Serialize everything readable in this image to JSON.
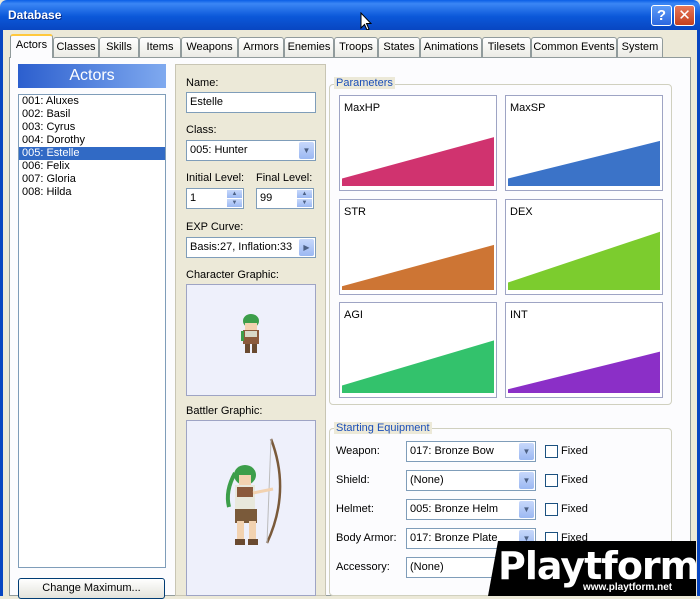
{
  "window": {
    "title": "Database"
  },
  "tabs": [
    "Actors",
    "Classes",
    "Skills",
    "Items",
    "Weapons",
    "Armors",
    "Enemies",
    "Troops",
    "States",
    "Animations",
    "Tilesets",
    "Common Events",
    "System"
  ],
  "actors": {
    "header": "Actors",
    "items": [
      "001: Aluxes",
      "002: Basil",
      "003: Cyrus",
      "004: Dorothy",
      "005: Estelle",
      "006: Felix",
      "007: Gloria",
      "008: Hilda"
    ],
    "selected": "005: Estelle",
    "change_max_label": "Change Maximum..."
  },
  "form": {
    "name_label": "Name:",
    "name_value": "Estelle",
    "class_label": "Class:",
    "class_value": "005: Hunter",
    "initial_level_label": "Initial Level:",
    "initial_level_value": "1",
    "final_level_label": "Final Level:",
    "final_level_value": "99",
    "exp_curve_label": "EXP Curve:",
    "exp_curve_value": "Basis:27, Inflation:33",
    "character_graphic_label": "Character Graphic:",
    "battler_graphic_label": "Battler Graphic:"
  },
  "parameters": {
    "title": "Parameters",
    "items": [
      {
        "name": "MaxHP",
        "color": "#d0336f",
        "start": 0.08,
        "end": 0.52
      },
      {
        "name": "MaxSP",
        "color": "#3b73c8",
        "start": 0.08,
        "end": 0.48
      },
      {
        "name": "STR",
        "color": "#cd7534",
        "start": 0.04,
        "end": 0.48
      },
      {
        "name": "DEX",
        "color": "#7ccc2e",
        "start": 0.08,
        "end": 0.62
      },
      {
        "name": "AGI",
        "color": "#33c26c",
        "start": 0.08,
        "end": 0.56
      },
      {
        "name": "INT",
        "color": "#8b2fc7",
        "start": 0.04,
        "end": 0.44
      }
    ]
  },
  "equipment": {
    "title": "Starting Equipment",
    "fixed_label": "Fixed",
    "rows": [
      {
        "label": "Weapon:",
        "value": "017: Bronze Bow"
      },
      {
        "label": "Shield:",
        "value": "(None)"
      },
      {
        "label": "Helmet:",
        "value": "005: Bronze Helm"
      },
      {
        "label": "Body Armor:",
        "value": "017: Bronze Plate"
      },
      {
        "label": "Accessory:",
        "value": "(None)"
      }
    ]
  },
  "watermark": {
    "logo_text": "Playtform",
    "url": "www.playtform.net"
  }
}
